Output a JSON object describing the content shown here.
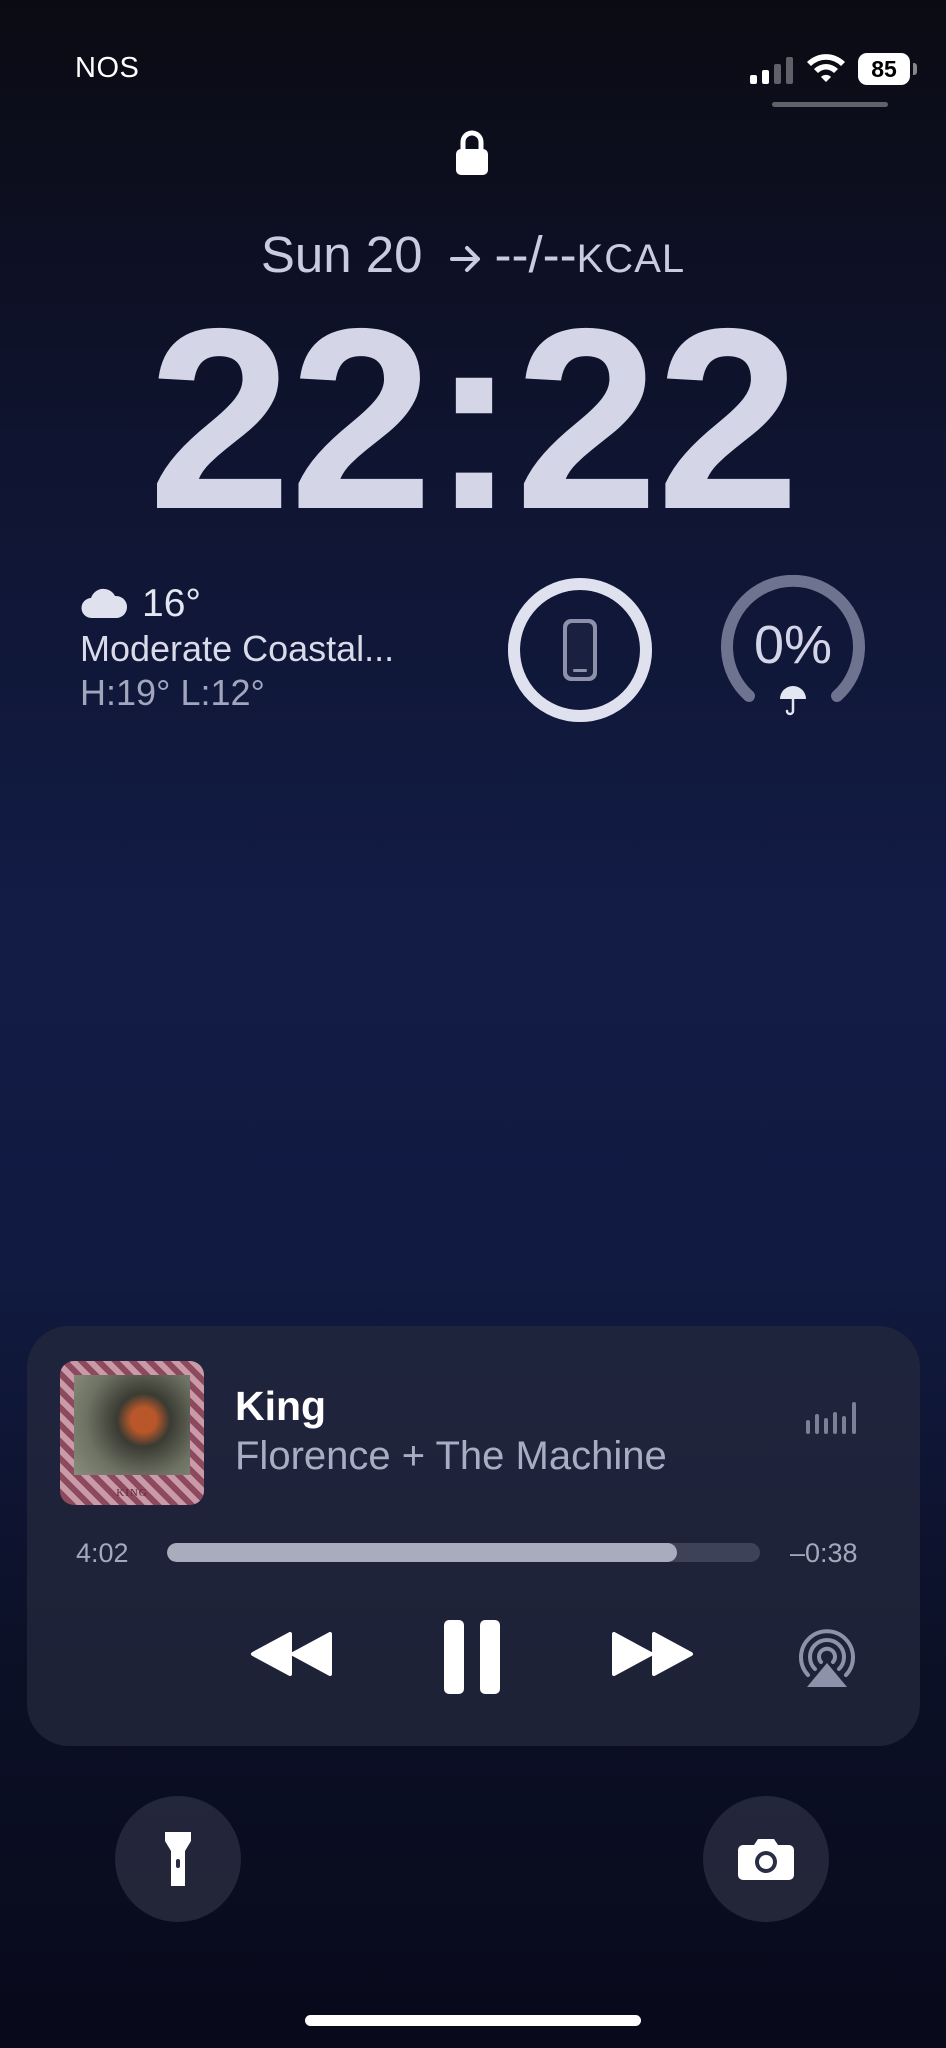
{
  "status_bar": {
    "carrier": "NOS",
    "battery_level": "85",
    "signal_bars_active": 2,
    "signal_bars_total": 4,
    "icons": [
      "cellular-signal-icon",
      "wifi-icon",
      "battery-icon"
    ]
  },
  "lock_screen": {
    "lock_icon": "lock-icon",
    "date": "Sun 20",
    "kcal_value": "--/--",
    "kcal_unit": "KCAL",
    "time": "22:22"
  },
  "widgets": {
    "weather": {
      "icon": "cloud-icon",
      "temperature": "16°",
      "condition": "Moderate Coastal...",
      "high_low": "H:19° L:12°"
    },
    "battery_ring": {
      "icon": "iphone-icon",
      "level_fraction": 1.0
    },
    "rain_ring": {
      "value": "0%",
      "icon": "umbrella-icon",
      "level_fraction": 0.0
    }
  },
  "now_playing": {
    "album_art_caption": "KING",
    "title": "King",
    "artist": "Florence + The Machine",
    "elapsed": "4:02",
    "remaining": "–0:38",
    "progress_fraction": 0.86,
    "controls": [
      "rewind-icon",
      "pause-icon",
      "fast-forward-icon",
      "airplay-icon"
    ]
  },
  "quick_actions": {
    "left": "flashlight-icon",
    "right": "camera-icon"
  },
  "colors": {
    "accent_text": "#d4d6e8",
    "ring_track": "#6e7390",
    "ring_fill": "#dfe1ee"
  }
}
